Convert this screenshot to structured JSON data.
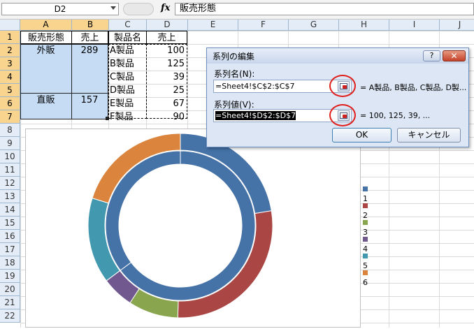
{
  "formula_bar": {
    "name_box": "D2",
    "fx_label": "fx",
    "content": "販売形態"
  },
  "columns": [
    {
      "letter": "A",
      "selected": true
    },
    {
      "letter": "B",
      "selected": true
    },
    {
      "letter": "C",
      "selected": false
    },
    {
      "letter": "D",
      "selected": false
    },
    {
      "letter": "E",
      "selected": false
    },
    {
      "letter": "F",
      "selected": false
    },
    {
      "letter": "G",
      "selected": false
    },
    {
      "letter": "H",
      "selected": false
    },
    {
      "letter": "I",
      "selected": false
    },
    {
      "letter": "J",
      "selected": false
    }
  ],
  "rows": [
    "1",
    "2",
    "3",
    "4",
    "5",
    "6",
    "7",
    "8",
    "9",
    "10",
    "11",
    "12",
    "13",
    "14",
    "15",
    "16",
    "17",
    "18",
    "19",
    "20",
    "21",
    "22"
  ],
  "selected_rows": 7,
  "table_ab": {
    "header_a": "販売形態",
    "header_b": "売上",
    "group1_label": "外販",
    "group1_value": "289",
    "group2_label": "直販",
    "group2_value": "157"
  },
  "table_cd": {
    "header_c": "製品名",
    "header_d": "売上",
    "products": [
      "A製品",
      "B製品",
      "C製品",
      "D製品",
      "E製品",
      "F製品"
    ],
    "values": [
      "100",
      "125",
      "39",
      "25",
      "67",
      "90"
    ]
  },
  "chart_data": {
    "type": "doughnut",
    "rings": [
      {
        "name": "inner",
        "values": [
          289,
          157
        ],
        "colors": [
          "#4572a7",
          "#4572a7"
        ]
      },
      {
        "name": "outer",
        "values": [
          100,
          125,
          39,
          25,
          67,
          90
        ],
        "colors": [
          "#4572a7",
          "#aa4643",
          "#89a54e",
          "#71588f",
          "#4198af",
          "#db843d"
        ]
      }
    ],
    "legend": {
      "placement": "right",
      "items": [
        {
          "label": "1",
          "color": "#4572a7"
        },
        {
          "label": "2",
          "color": "#aa4643"
        },
        {
          "label": "3",
          "color": "#89a54e"
        },
        {
          "label": "4",
          "color": "#71588f"
        },
        {
          "label": "5",
          "color": "#4198af"
        },
        {
          "label": "6",
          "color": "#db843d"
        }
      ]
    }
  },
  "dialog": {
    "title": "系列の編集",
    "help_label": "?",
    "close_label": "✕",
    "series_name_label": "系列名(N):",
    "series_name_value": "=Sheet4!$C$2:$C$7",
    "series_name_preview": "= A製品, B製品, C製品, D製...",
    "series_values_label": "系列値(V):",
    "series_values_value": "=Sheet4!$D$2:$D$7",
    "series_values_preview": "= 100, 125, 39, ...",
    "ok_label": "OK",
    "cancel_label": "キャンセル"
  }
}
